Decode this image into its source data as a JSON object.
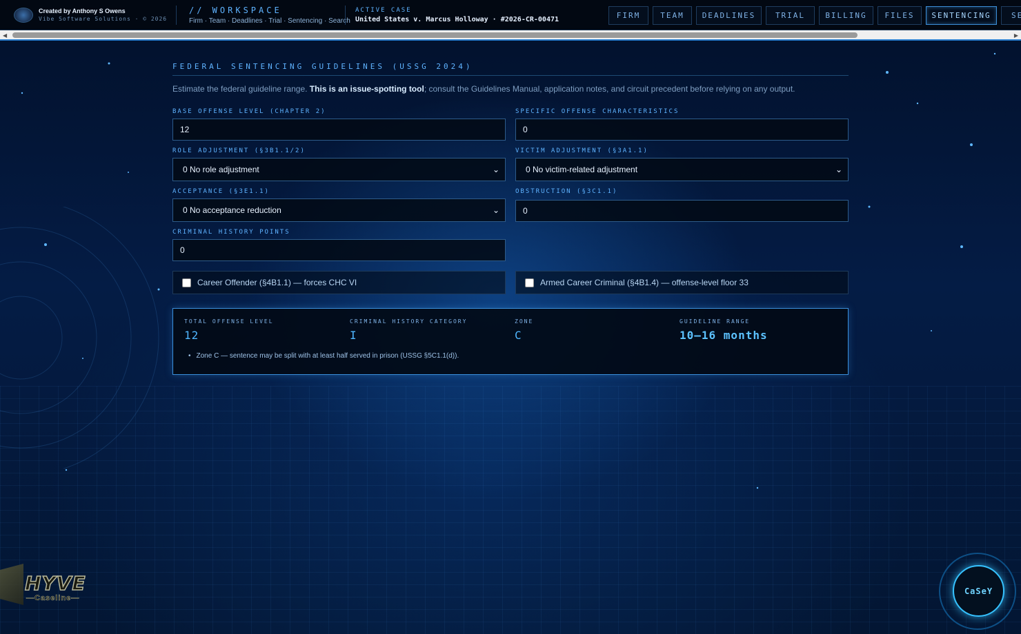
{
  "header": {
    "credit_name": "Created by Anthony S Owens",
    "credit_sub": "Vibe Software Solutions · © 2026",
    "workspace_title": "// WORKSPACE",
    "workspace_links": "Firm · Team · Deadlines · Trial · Sentencing · Search",
    "active_case_label": "ACTIVE CASE",
    "active_case_value": "United States v. Marcus Holloway · #2026-CR-00471",
    "tabs": [
      "FIRM",
      "TEAM",
      "DEADLINES",
      "TRIAL",
      "BILLING",
      "FILES",
      "SENTENCING",
      "SEA"
    ],
    "active_tab": "SENTENCING"
  },
  "sentencing": {
    "title": "FEDERAL SENTENCING GUIDELINES (USSG 2024)",
    "intro_pre": "Estimate the federal guideline range. ",
    "intro_bold": "This is an issue-spotting tool",
    "intro_post": "; consult the Guidelines Manual, application notes, and circuit precedent before relying on any output.",
    "fields": {
      "base_offense_label": "BASE OFFENSE LEVEL (CHAPTER 2)",
      "base_offense_value": "12",
      "soc_label": "SPECIFIC OFFENSE CHARACTERISTICS",
      "soc_value": "0",
      "role_label": "ROLE ADJUSTMENT (§3B1.1/2)",
      "role_value": "0 No role adjustment",
      "victim_label": "VICTIM ADJUSTMENT (§3A1.1)",
      "victim_value": "0 No victim-related adjustment",
      "acceptance_label": "ACCEPTANCE (§3E1.1)",
      "acceptance_value": "0 No acceptance reduction",
      "obstruction_label": "OBSTRUCTION (§3C1.1)",
      "obstruction_value": "0",
      "chp_label": "CRIMINAL HISTORY POINTS",
      "chp_value": "0"
    },
    "checkboxes": {
      "career_offender": "Career Offender (§4B1.1) — forces CHC VI",
      "armed_career": "Armed Career Criminal (§4B1.4) — offense-level floor 33"
    },
    "result": {
      "total_label": "TOTAL OFFENSE LEVEL",
      "total_value": "12",
      "chc_label": "CRIMINAL HISTORY CATEGORY",
      "chc_value": "I",
      "zone_label": "ZONE",
      "zone_value": "C",
      "range_label": "GUIDELINE RANGE",
      "range_value": "10–16 months",
      "note": "Zone C — sentence may be split with at least half served in prison (USSG §5C1.1(d))."
    }
  },
  "branding": {
    "logo_word": "HYVE",
    "logo_sub": "—Caseline—"
  },
  "assistant": {
    "label": "CaSeY"
  },
  "colors": {
    "accent": "#5fb3ff",
    "border": "#2d5b8a",
    "result_border": "#3a8fdc",
    "background": "#041c45"
  }
}
